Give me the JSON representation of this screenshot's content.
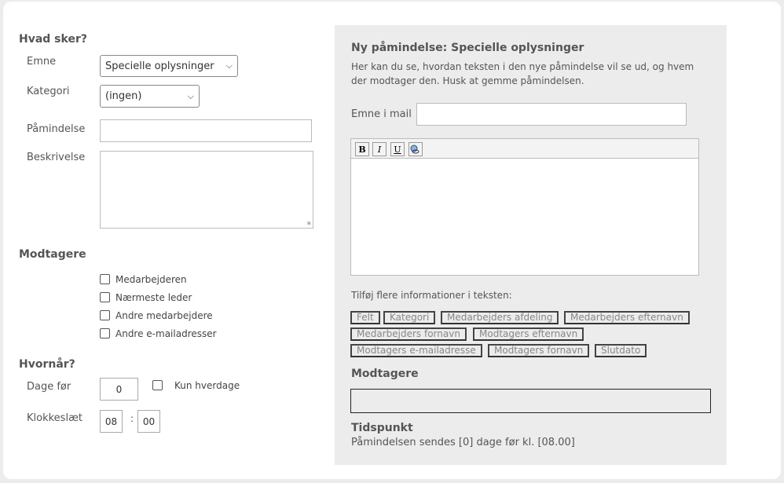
{
  "left": {
    "what_title": "Hvad sker?",
    "subject_label": "Emne",
    "subject_value": "Specielle oplysninger",
    "category_label": "Kategori",
    "category_value": "(ingen)",
    "reminder_label": "Påmindelse",
    "reminder_value": "",
    "description_label": "Beskrivelse",
    "description_value": "",
    "recipients_title": "Modtagere",
    "recipients": [
      {
        "label": "Medarbejderen",
        "checked": false
      },
      {
        "label": "Nærmeste leder",
        "checked": false
      },
      {
        "label": "Andre medarbejdere",
        "checked": false
      },
      {
        "label": "Andre e-mailadresser",
        "checked": false
      }
    ],
    "when_title": "Hvornår?",
    "days_before_label": "Dage før",
    "days_before_value": "0",
    "weekdays_label": "Kun hverdage",
    "time_label": "Klokkeslæt",
    "time_hour": "08",
    "time_sep": ":",
    "time_minute": "00"
  },
  "right": {
    "title": "Ny påmindelse: Specielle oplysninger",
    "description": "Her kan du se, hvordan teksten i den nye påmindelse vil se ud, og hvem der modtager den. Husk at gemme påmindelsen.",
    "mail_subject_label": "Emne i mail",
    "mail_subject_value": "",
    "toolbar": {
      "bold": "B",
      "italic": "I",
      "underline": "U"
    },
    "add_info_label": "Tilføj flere informationer i teksten:",
    "tokens": [
      "Felt",
      "Kategori",
      "Medarbejders afdeling",
      "Medarbejders efternavn",
      "Medarbejders fornavn",
      "Modtagers efternavn",
      "Modtagers e-mailadresse",
      "Modtagers fornavn",
      "Slutdato"
    ],
    "recipients_title": "Modtagere",
    "time_title": "Tidspunkt",
    "time_text": "Påmindelsen sendes [0] dage før kl. [08.00]"
  }
}
